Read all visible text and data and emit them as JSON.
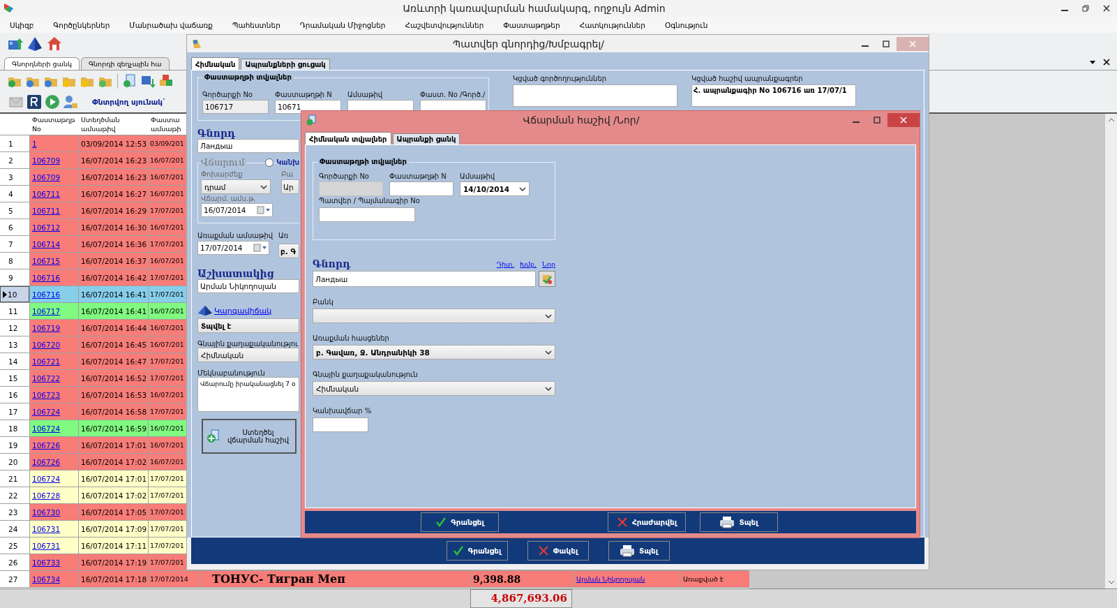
{
  "window": {
    "title": "Առևտրի կառավարման համակարգ, ողջույն Admin"
  },
  "menu": [
    "Սկիզբ",
    "Գործընկերներ",
    "Մանրածախ վաճառք",
    "Պահեստներ",
    "Դրամական Միջոցներ",
    "Հաշվետվություններ",
    "Փաստաթղթեր",
    "Հատկություններ",
    "Օգնություն"
  ],
  "main_tabs": [
    {
      "label": "Գնորդների ցանկ",
      "selected": true
    },
    {
      "label": "Գնորդի զեղչային հա",
      "selected": false
    }
  ],
  "search_column_label": "Փնտրվող սյունակ`",
  "table": {
    "columns": [
      "Փաստաթղթ No",
      "Ստեղծման ամսաթիվ",
      "Փաստա ամսաթի"
    ],
    "rows": [
      {
        "num": "1",
        "doc": "1",
        "created": "03/09/2014 12:53",
        "date": "03/09/201",
        "color": "#f87c78",
        "selected": false
      },
      {
        "num": "2",
        "doc": "106709",
        "created": "16/07/2014 16:23",
        "date": "16/07/201",
        "color": "#f87c78",
        "selected": false
      },
      {
        "num": "3",
        "doc": "106709",
        "created": "16/07/2014 16:23",
        "date": "16/07/201",
        "color": "#f87c78",
        "selected": false
      },
      {
        "num": "4",
        "doc": "106711",
        "created": "16/07/2014 16:27",
        "date": "16/07/201",
        "color": "#f87c78",
        "selected": false
      },
      {
        "num": "5",
        "doc": "106711",
        "created": "16/07/2014 16:29",
        "date": "17/07/201",
        "color": "#f87c78",
        "selected": false
      },
      {
        "num": "6",
        "doc": "106712",
        "created": "16/07/2014 16:30",
        "date": "16/07/201",
        "color": "#f87c78",
        "selected": false
      },
      {
        "num": "7",
        "doc": "106714",
        "created": "16/07/2014 16:36",
        "date": "17/07/201",
        "color": "#f87c78",
        "selected": false
      },
      {
        "num": "8",
        "doc": "106715",
        "created": "16/07/2014 16:37",
        "date": "16/07/201",
        "color": "#f87c78",
        "selected": false
      },
      {
        "num": "9",
        "doc": "106716",
        "created": "16/07/2014 16:42",
        "date": "17/07/201",
        "color": "#f87c78",
        "selected": false
      },
      {
        "num": "10",
        "doc": "106716",
        "created": "16/07/2014 16:41",
        "date": "17/07/201",
        "color": "#87ceeb",
        "selected": true
      },
      {
        "num": "11",
        "doc": "106717",
        "created": "16/07/2014 16:41",
        "date": "16/07/201",
        "color": "#80fa80",
        "selected": false
      },
      {
        "num": "12",
        "doc": "106719",
        "created": "16/07/2014 16:44",
        "date": "16/07/201",
        "color": "#f87c78",
        "selected": false
      },
      {
        "num": "13",
        "doc": "106720",
        "created": "16/07/2014 16:45",
        "date": "16/07/201",
        "color": "#f87c78",
        "selected": false
      },
      {
        "num": "14",
        "doc": "106721",
        "created": "16/07/2014 16:47",
        "date": "17/07/201",
        "color": "#f87c78",
        "selected": false
      },
      {
        "num": "15",
        "doc": "106722",
        "created": "16/07/2014 16:52",
        "date": "17/07/201",
        "color": "#f87c78",
        "selected": false
      },
      {
        "num": "16",
        "doc": "106723",
        "created": "16/07/2014 16:53",
        "date": "16/07/201",
        "color": "#f87c78",
        "selected": false
      },
      {
        "num": "17",
        "doc": "106724",
        "created": "16/07/2014 16:58",
        "date": "17/07/201",
        "color": "#f87c78",
        "selected": false
      },
      {
        "num": "18",
        "doc": "106724",
        "created": "16/07/2014 16:59",
        "date": "16/07/201",
        "color": "#80fa80",
        "selected": false
      },
      {
        "num": "19",
        "doc": "106726",
        "created": "16/07/2014 17:01",
        "date": "16/07/201",
        "color": "#f87c78",
        "selected": false
      },
      {
        "num": "20",
        "doc": "106726",
        "created": "16/07/2014 17:02",
        "date": "16/07/201",
        "color": "#f87c78",
        "selected": false
      },
      {
        "num": "21",
        "doc": "106724",
        "created": "16/07/2014 17:01",
        "date": "17/07/201",
        "color": "#ffffc8",
        "selected": false
      },
      {
        "num": "22",
        "doc": "106728",
        "created": "16/07/2014 17:02",
        "date": "17/07/201",
        "color": "#ffffc8",
        "selected": false
      },
      {
        "num": "23",
        "doc": "106730",
        "created": "16/07/2014 17:05",
        "date": "17/07/201",
        "color": "#f87c78",
        "selected": false
      },
      {
        "num": "24",
        "doc": "106731",
        "created": "16/07/2014 17:09",
        "date": "17/07/201",
        "color": "#ffffc8",
        "selected": false
      },
      {
        "num": "25",
        "doc": "106731",
        "created": "16/07/2014 17:11",
        "date": "17/07/201",
        "color": "#ffffc8",
        "selected": false
      },
      {
        "num": "26",
        "doc": "106733",
        "created": "16/07/2014 17:19",
        "date": "17/07/201",
        "color": "#f87c78",
        "selected": false
      },
      {
        "num": "27",
        "doc": "106734",
        "created": "16/07/2014 17:18",
        "date": "17/07/2014",
        "color": "#f87c78",
        "selected": false,
        "customer": "ТОНУС- Тигран Меп",
        "amount": "9,398.88",
        "employee": "Արման Նիկողոսյան",
        "status": "Առաքված է"
      }
    ]
  },
  "total": "4,867,693.06",
  "order_dialog": {
    "title": "Պատվեր գնորդից/Խմբագրել/",
    "tabs": [
      {
        "label": "Հիմնական",
        "selected": true
      },
      {
        "label": "Ապրանքների ցուցակ",
        "selected": false
      }
    ],
    "doc_group": {
      "title": "Փաստաթղթի տվյալներ",
      "fields": [
        {
          "label": "Գործարքի No",
          "value": "106717"
        },
        {
          "label": "Փաստաթղթի N",
          "value": "10671"
        },
        {
          "label": "Ամսաթիվ"
        },
        {
          "label": "Փաստ. No /Գործ./"
        }
      ]
    },
    "linked_actions": {
      "label": "Կցված գործողություններ"
    },
    "linked_invoices": {
      "label": "Կցված հաշիվ ապրանքագրեր",
      "items": [
        "Հ. ապրանքագիր No 106716 առ 17/07/1"
      ]
    },
    "customer": {
      "label": "Գնորդ",
      "value": "Ландыш"
    },
    "payment": {
      "label": "Վճարում",
      "radio_label": "Կանխ",
      "radio_selected": false,
      "currency_label": "Փոխարժեք",
      "currency": "դրամ",
      "bank_label": "Բա",
      "bank": "Ար",
      "date_label": "Վճարմ. ամս.թ.",
      "date": "16/07/2014"
    },
    "delivery_date": {
      "label": "Առաքման ամսաթիվ",
      "value": "17/07/2014"
    },
    "delivery_address": {
      "label": "Առ",
      "value": "բ. Գ"
    },
    "employee": {
      "label": "Աշխատակից",
      "value": "Արման Նիկողոսյան"
    },
    "status": {
      "link": "Կարգավիճակ",
      "value": "Տպվել է"
    },
    "price_policy": {
      "label": "Գնային քաղաքականությու",
      "value": "Հիմնական"
    },
    "comment": {
      "label": "Մեկնաբանություն",
      "value": "Վճարումը իրականացնել 7 օ"
    },
    "create_invoice_button": "Ստեղծել վճարման հաշիվ",
    "buttons": [
      {
        "kind": "save",
        "label": "Գրանցել"
      },
      {
        "kind": "close",
        "label": "Փակել"
      },
      {
        "kind": "print",
        "label": "Տպել"
      }
    ]
  },
  "invoice_dialog": {
    "title": "Վճարման հաշիվ /Նոր/",
    "tabs": [
      {
        "label": "Հիմնական տվյալներ",
        "selected": true
      },
      {
        "label": "Ապրանքի ցանկ",
        "selected": false
      }
    ],
    "doc_group": {
      "title": "Փաստաթղթի տվյալներ",
      "fields": [
        {
          "label": "Գործարքի No",
          "disabled": true
        },
        {
          "label": "Փաստաթղթի N",
          "disabled": false
        },
        {
          "label": "Ամսաթիվ",
          "value": "14/10/2014",
          "disabled": false
        }
      ],
      "order_field": {
        "label": "Պատվեր / Պայմանագիր No"
      }
    },
    "customer": {
      "label": "Գնորդ",
      "links": [
        "Դիտ.",
        "Խմբ.",
        "Նոր"
      ],
      "value": "Ландыш"
    },
    "bank": {
      "label": "Բանկ"
    },
    "address": {
      "label": "Առաքման հասցեներ",
      "value": "բ. Գավառ, Ջ. Անդրանիկի 38"
    },
    "price_policy": {
      "label": "Գնային քաղաքականություն",
      "value": "Հիմնական"
    },
    "prepayment": {
      "label": "Կանխավճար %"
    },
    "buttons": [
      {
        "kind": "save",
        "label": "Գրանցել"
      },
      {
        "kind": "cancel",
        "label": "Հրաժարվել"
      },
      {
        "kind": "print",
        "label": "Տպել"
      }
    ]
  }
}
